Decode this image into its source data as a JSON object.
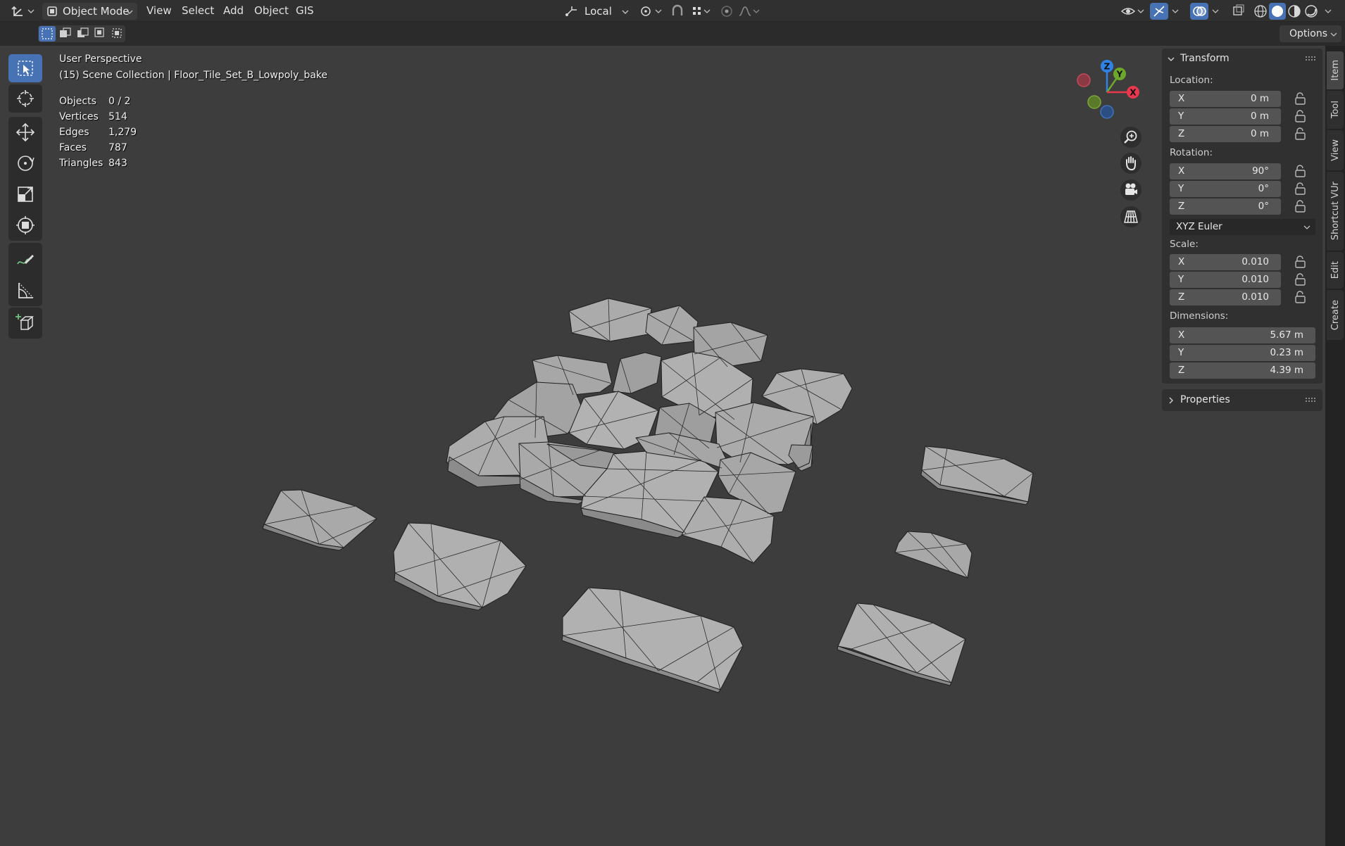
{
  "header": {
    "mode_label": "Object Mode",
    "menu": [
      "View",
      "Select",
      "Add",
      "Object",
      "GIS"
    ],
    "transform_orientation": "Local",
    "options_label": "Options"
  },
  "overlay": {
    "view_name": "User Perspective",
    "collection_path": "(15) Scene Collection | Floor_Tile_Set_B_Lowpoly_bake",
    "stats": [
      {
        "label": "Objects",
        "value": "0 / 2"
      },
      {
        "label": "Vertices",
        "value": "514"
      },
      {
        "label": "Edges",
        "value": "1,279"
      },
      {
        "label": "Faces",
        "value": "787"
      },
      {
        "label": "Triangles",
        "value": "843"
      }
    ]
  },
  "gizmo": {
    "x": "X",
    "y": "Y",
    "z": "Z",
    "x_color": "#e8384e",
    "y_color": "#6da72b",
    "z_color": "#2f83e4"
  },
  "panel": {
    "transform_title": "Transform",
    "location_label": "Location:",
    "location": [
      {
        "axis": "X",
        "value": "0 m"
      },
      {
        "axis": "Y",
        "value": "0 m"
      },
      {
        "axis": "Z",
        "value": "0 m"
      }
    ],
    "rotation_label": "Rotation:",
    "rotation": [
      {
        "axis": "X",
        "value": "90°"
      },
      {
        "axis": "Y",
        "value": "0°"
      },
      {
        "axis": "Z",
        "value": "0°"
      }
    ],
    "rotation_mode": "XYZ Euler",
    "scale_label": "Scale:",
    "scale": [
      {
        "axis": "X",
        "value": "0.010"
      },
      {
        "axis": "Y",
        "value": "0.010"
      },
      {
        "axis": "Z",
        "value": "0.010"
      }
    ],
    "dimensions_label": "Dimensions:",
    "dimensions": [
      {
        "axis": "X",
        "value": "5.67 m"
      },
      {
        "axis": "Y",
        "value": "0.23 m"
      },
      {
        "axis": "Z",
        "value": "4.39 m"
      }
    ],
    "properties_title": "Properties"
  },
  "tabs": [
    "Item",
    "Tool",
    "View",
    "Shortcut VUr",
    "Edit",
    "Create"
  ],
  "colors": {
    "accent": "#4772b3",
    "header": "#303030",
    "viewport": "#3d3d3d",
    "field": "#545454"
  }
}
